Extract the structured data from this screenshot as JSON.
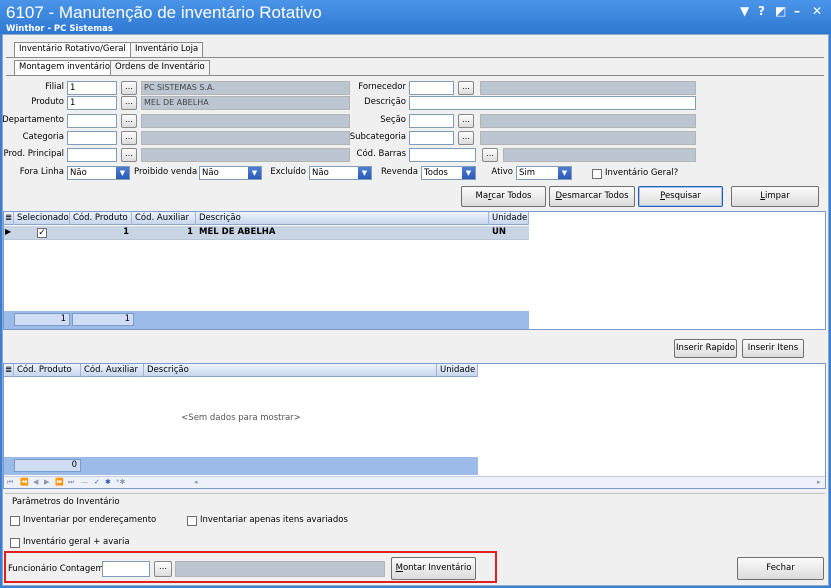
{
  "window": {
    "title": "6107 - Manutenção de inventário Rotativo",
    "subtitle": "Winthor - PC Sistemas",
    "controls": [
      "▼",
      "?",
      "◩",
      "–",
      "✕"
    ]
  },
  "tabs_main": [
    "Inventário Rotativo/Geral",
    "Inventário Loja"
  ],
  "tabs_sub": [
    "Montagem inventário",
    "Ordens de Inventário"
  ],
  "form": {
    "filial": {
      "label": "Filial",
      "value": "1",
      "desc": "PC SISTEMAS S.A."
    },
    "produto": {
      "label": "Produto",
      "value": "1",
      "desc": "MEL DE ABELHA"
    },
    "departamento": {
      "label": "Departamento",
      "value": "",
      "desc": ""
    },
    "categoria": {
      "label": "Categoria",
      "value": "",
      "desc": ""
    },
    "prod_principal": {
      "label": "Prod. Principal",
      "value": "",
      "desc": ""
    },
    "fornecedor": {
      "label": "Fornecedor",
      "value": "",
      "desc": ""
    },
    "descricao": {
      "label": "Descrição",
      "value": ""
    },
    "secao": {
      "label": "Seção",
      "value": "",
      "desc": ""
    },
    "subcategoria": {
      "label": "Subcategoria",
      "value": "",
      "desc": ""
    },
    "cod_barras": {
      "label": "Cód. Barras",
      "value": "",
      "desc": ""
    },
    "fora_linha": {
      "label": "Fora Linha",
      "value": "Não"
    },
    "proibido_venda": {
      "label": "Proibido venda",
      "value": "Não"
    },
    "excluido": {
      "label": "Excluído",
      "value": "Não"
    },
    "revenda": {
      "label": "Revenda",
      "value": "Todos"
    },
    "ativo": {
      "label": "Ativo",
      "value": "Sim"
    },
    "inventario_geral": {
      "label": "Inventário Geral?",
      "checked": false
    }
  },
  "buttons": {
    "marcar_todos": {
      "pre": "Ma",
      "key": "r",
      "post": "car Todos"
    },
    "desmarcar_todos": {
      "pre": "",
      "key": "D",
      "post": "esmarcar Todos"
    },
    "pesquisar": {
      "pre": "",
      "key": "P",
      "post": "esquisar"
    },
    "limpar": {
      "pre": "",
      "key": "L",
      "post": "impar"
    },
    "inserir_rapido": "Inserir Rapido",
    "inserir_itens": "Inserir Itens",
    "montar_inventario": {
      "pre": "",
      "key": "M",
      "post": "ontar Inventário"
    },
    "fechar": "Fechar"
  },
  "grid1": {
    "columns": [
      "Selecionado",
      "Cód. Produto",
      "Cód. Auxiliar",
      "Descrição",
      "Unidade"
    ],
    "rows": [
      {
        "selected": true,
        "cod_produto": "1",
        "cod_auxiliar": "1",
        "descricao": "MEL DE ABELHA",
        "unidade": "UN"
      }
    ],
    "footer": [
      "1",
      "1"
    ]
  },
  "grid2": {
    "columns": [
      "Cód. Produto",
      "Cód. Auxiliar",
      "Descrição",
      "Unidade"
    ],
    "empty_text": "<Sem dados para mostrar>",
    "footer": [
      "0"
    ],
    "nav": [
      "⏮",
      "⏪",
      "◀",
      "▶",
      "⏩",
      "⏭",
      "—",
      "✓",
      "✱",
      "*✱"
    ]
  },
  "params": {
    "title": "Parâmetros do Inventário",
    "por_endereco": "Inventariar por endereçamento",
    "apenas_avariados": "Inventariar apenas itens avariados",
    "geral_avaria": "Inventário geral + avaria"
  },
  "funcionario": {
    "label": "Funcionário Contagem",
    "value": "",
    "desc": ""
  },
  "colors": {
    "accent": "#3b7fd4",
    "highlight_box": "#e02020",
    "grid_header": "#c6d6ee",
    "grid_footer": "#9dbbe8"
  }
}
